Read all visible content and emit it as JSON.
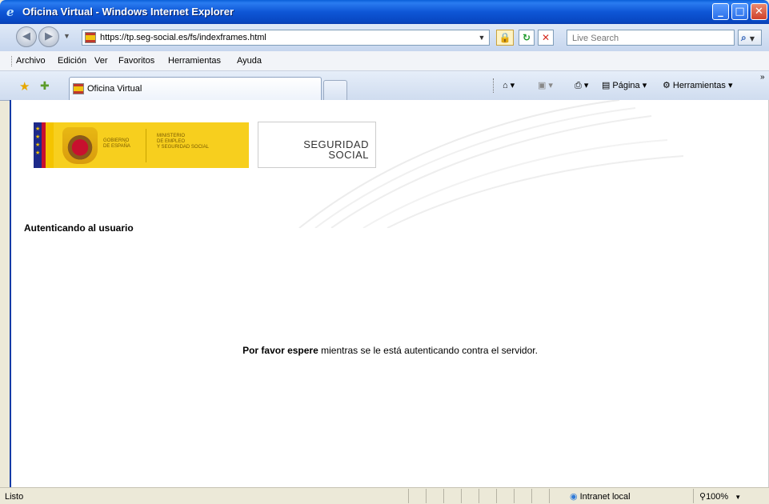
{
  "window": {
    "title": "Oficina Virtual - Windows Internet Explorer",
    "controls": {
      "minimize": "_",
      "maximize": "□",
      "close": "✕"
    }
  },
  "navigation": {
    "back_glyph": "◀",
    "forward_glyph": "▶",
    "address": "https://tp.seg-social.es/fs/indexframes.html",
    "search_placeholder": "Live Search"
  },
  "menu": {
    "items": [
      "Archivo",
      "Edición",
      "Ver",
      "Favoritos",
      "Herramientas",
      "Ayuda"
    ]
  },
  "tabs": {
    "active_tab": "Oficina Virtual"
  },
  "command_bar": {
    "page_label": "Página",
    "tools_label": "Herramientas",
    "chevron": "»"
  },
  "page": {
    "gov_line1": "GOBIERNO",
    "gov_line2": "DE ESPAÑA",
    "ministry_line1": "MINISTERIO",
    "ministry_line2": "DE EMPLEO",
    "ministry_line3": "Y SEGURIDAD SOCIAL",
    "ss_line1": "SEGURIDAD",
    "ss_line2": "SOCIAL",
    "heading": "Autenticando al usuario",
    "wait_bold": "Por favor espere",
    "wait_rest": " mientras se le está autenticando contra el servidor."
  },
  "status": {
    "text": "Listo",
    "zone": "Intranet local",
    "zoom": "100%"
  },
  "colors": {
    "titlebar": "#0a5fd8",
    "banner_yellow": "#f7cf1e",
    "content_border": "#0f3aa6"
  }
}
